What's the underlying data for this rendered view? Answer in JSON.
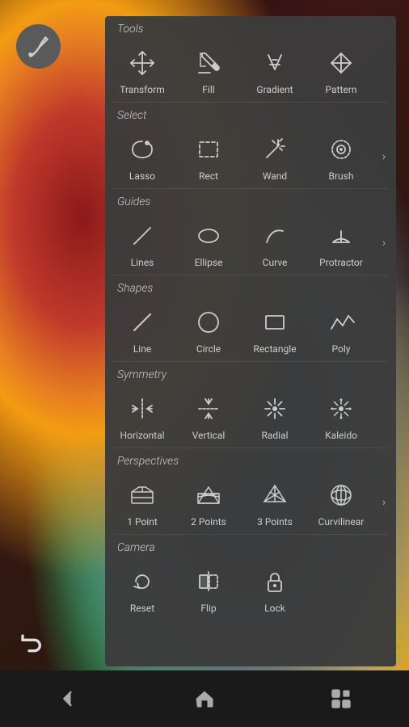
{
  "panel": {
    "title": "Tools",
    "sections": [
      {
        "id": "section-tools",
        "label": "Tools",
        "tools": [
          {
            "id": "transform",
            "label": "Transform",
            "icon": "move"
          },
          {
            "id": "fill",
            "label": "Fill",
            "icon": "fill"
          },
          {
            "id": "gradient",
            "label": "Gradient",
            "icon": "gradient"
          },
          {
            "id": "pattern",
            "label": "Pattern",
            "icon": "pattern"
          }
        ],
        "hasArrow": false
      },
      {
        "id": "section-select",
        "label": "Select",
        "tools": [
          {
            "id": "lasso",
            "label": "Lasso",
            "icon": "lasso"
          },
          {
            "id": "rect",
            "label": "Rect",
            "icon": "rect-select"
          },
          {
            "id": "wand",
            "label": "Wand",
            "icon": "wand"
          },
          {
            "id": "brush-select",
            "label": "Brush",
            "icon": "brush-select"
          }
        ],
        "hasArrow": true
      },
      {
        "id": "section-guides",
        "label": "Guides",
        "tools": [
          {
            "id": "lines",
            "label": "Lines",
            "icon": "lines"
          },
          {
            "id": "ellipse",
            "label": "Ellipse",
            "icon": "ellipse"
          },
          {
            "id": "curve",
            "label": "Curve",
            "icon": "curve"
          },
          {
            "id": "protractor",
            "label": "Protractor",
            "icon": "protractor"
          }
        ],
        "hasArrow": true
      },
      {
        "id": "section-shapes",
        "label": "Shapes",
        "tools": [
          {
            "id": "line",
            "label": "Line",
            "icon": "line"
          },
          {
            "id": "circle",
            "label": "Circle",
            "icon": "circle"
          },
          {
            "id": "rectangle",
            "label": "Rectangle",
            "icon": "rectangle"
          },
          {
            "id": "poly",
            "label": "Poly",
            "icon": "poly"
          }
        ],
        "hasArrow": false
      },
      {
        "id": "section-symmetry",
        "label": "Symmetry",
        "tools": [
          {
            "id": "horizontal",
            "label": "Horizontal",
            "icon": "sym-horizontal"
          },
          {
            "id": "vertical",
            "label": "Vertical",
            "icon": "sym-vertical"
          },
          {
            "id": "radial",
            "label": "Radial",
            "icon": "sym-radial"
          },
          {
            "id": "kaleido",
            "label": "Kaleido",
            "icon": "sym-kaleido"
          }
        ],
        "hasArrow": false
      },
      {
        "id": "section-perspectives",
        "label": "Perspectives",
        "tools": [
          {
            "id": "1point",
            "label": "1 Point",
            "icon": "persp-1"
          },
          {
            "id": "2points",
            "label": "2 Points",
            "icon": "persp-2"
          },
          {
            "id": "3points",
            "label": "3 Points",
            "icon": "persp-3"
          },
          {
            "id": "curvilinear",
            "label": "Curvilinear",
            "icon": "persp-curv"
          }
        ],
        "hasArrow": true
      },
      {
        "id": "section-camera",
        "label": "Camera",
        "tools": [
          {
            "id": "reset",
            "label": "Reset",
            "icon": "reset"
          },
          {
            "id": "flip",
            "label": "Flip",
            "icon": "flip"
          },
          {
            "id": "lock",
            "label": "Lock",
            "icon": "lock"
          }
        ],
        "hasArrow": false
      }
    ]
  },
  "navbar": {
    "back_label": "back",
    "home_label": "home",
    "recent_label": "recent"
  },
  "watermark": "MyPrice",
  "watermark_sub": "myprice.com.cn"
}
